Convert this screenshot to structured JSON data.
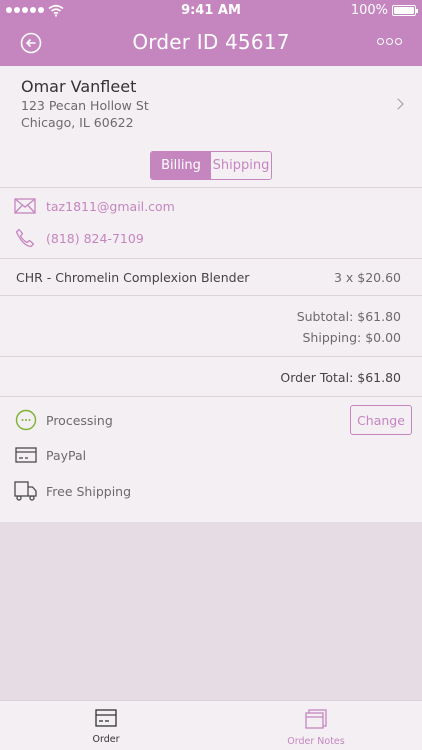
{
  "status_bar": {
    "time": "9:41 AM",
    "battery": "100%"
  },
  "header": {
    "title": "Order ID 45617"
  },
  "customer": {
    "name": "Omar Vanfleet",
    "address_line1": "123 Pecan Hollow St",
    "address_line2": "Chicago, IL 60622"
  },
  "address_toggle": {
    "billing": "Billing",
    "shipping": "Shipping"
  },
  "contact": {
    "email": "taz1811@gmail.com",
    "phone": "(818) 824-7109"
  },
  "line_item": {
    "name": "CHR - Chromelin Complexion Blender",
    "qty_price": "3 x $20.60"
  },
  "summary": {
    "subtotal": "Subtotal: $61.80",
    "shipping": "Shipping: $0.00",
    "total": "Order Total: $61.80"
  },
  "status": {
    "label": "Processing",
    "change_label": "Change"
  },
  "payment": {
    "label": "PayPal"
  },
  "shipping_method": {
    "label": "Free Shipping"
  },
  "tabs": {
    "order": "Order",
    "notes": "Order Notes"
  },
  "colors": {
    "accent": "#c586c0",
    "processing": "#7ab332",
    "background": "#e5dde3",
    "card": "#f4eff3"
  }
}
